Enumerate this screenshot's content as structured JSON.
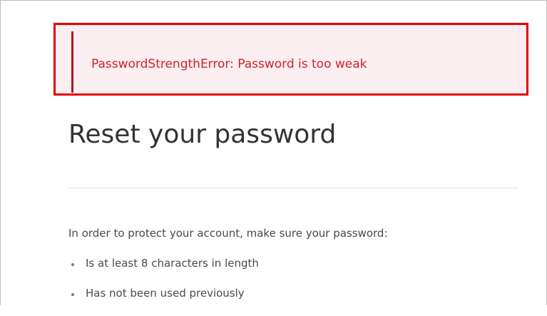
{
  "alert": {
    "message": "PasswordStrengthError: Password is too weak"
  },
  "page": {
    "title": "Reset your password",
    "intro": "In order to protect your account, make sure your password:"
  },
  "requirements": [
    "Is at least 8 characters in length",
    "Has not been used previously"
  ],
  "colors": {
    "error_text": "#d0212b",
    "error_background": "#fbeef0",
    "highlight_border": "#e60000",
    "body_text": "#4a4a4a",
    "title_text": "#333333"
  }
}
